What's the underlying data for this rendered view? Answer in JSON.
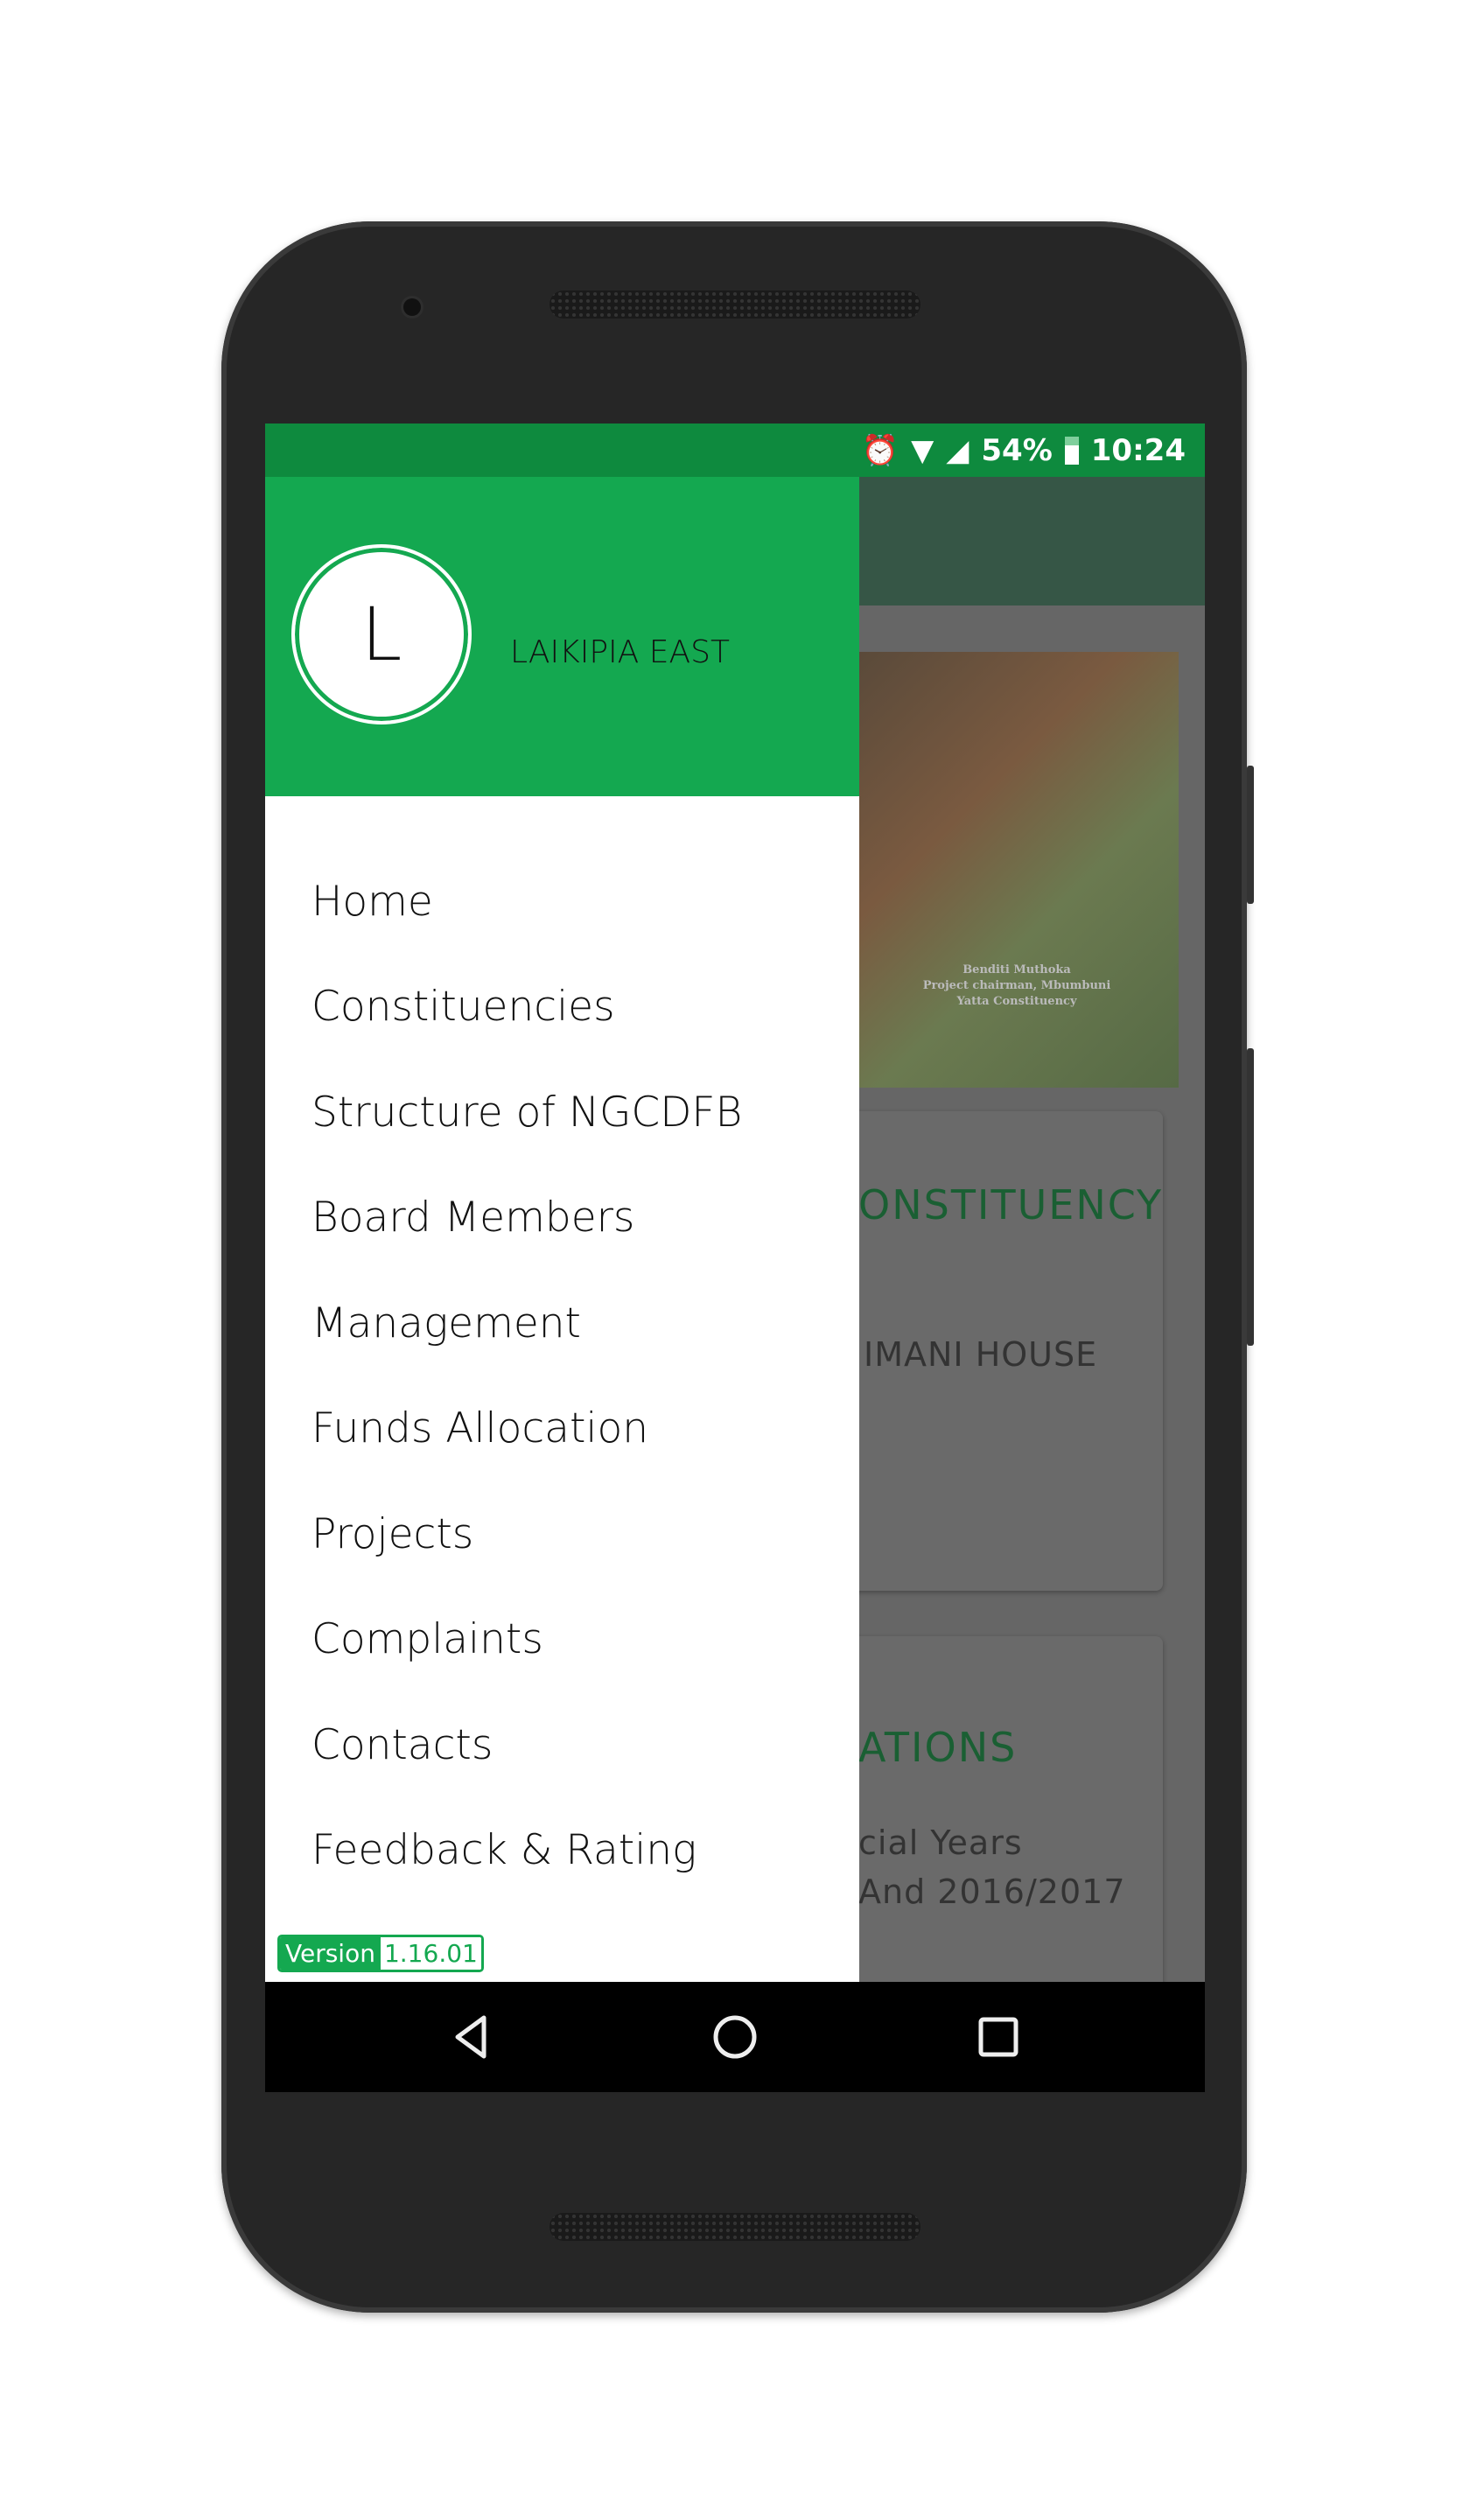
{
  "status_bar": {
    "battery": "54%",
    "time": "10:24",
    "icons": [
      "alarm-icon",
      "wifi-icon",
      "signal-icon",
      "battery-icon"
    ]
  },
  "drawer": {
    "avatar_letter": "L",
    "user_name": "LAIKIPIA EAST",
    "items": [
      {
        "label": "Home"
      },
      {
        "label": "Constituencies"
      },
      {
        "label": "Structure of NGCDFB"
      },
      {
        "label": "Board Members"
      },
      {
        "label": "Management"
      },
      {
        "label": "Funds Allocation"
      },
      {
        "label": "Projects"
      },
      {
        "label": "Complaints"
      },
      {
        "label": "Contacts"
      },
      {
        "label": "Feedback & Rating"
      }
    ],
    "version_label": "Version",
    "version_number": "1.16.01"
  },
  "background": {
    "photo_caption": [
      "Benditi Muthoka",
      "Project chairman, Mbumbuni",
      "Yatta Constituency"
    ],
    "card1": {
      "title": "ONSTITUENCY",
      "subtitle": "IMANI HOUSE"
    },
    "card2": {
      "title": "ATIONS",
      "line1": "cial Years",
      "line2": "And 2016/2017"
    }
  },
  "navbar": {
    "buttons": [
      "back",
      "home",
      "recents"
    ]
  },
  "colors": {
    "primary": "#14a850",
    "status": "#0e8a3e",
    "scrim": "#666666"
  }
}
